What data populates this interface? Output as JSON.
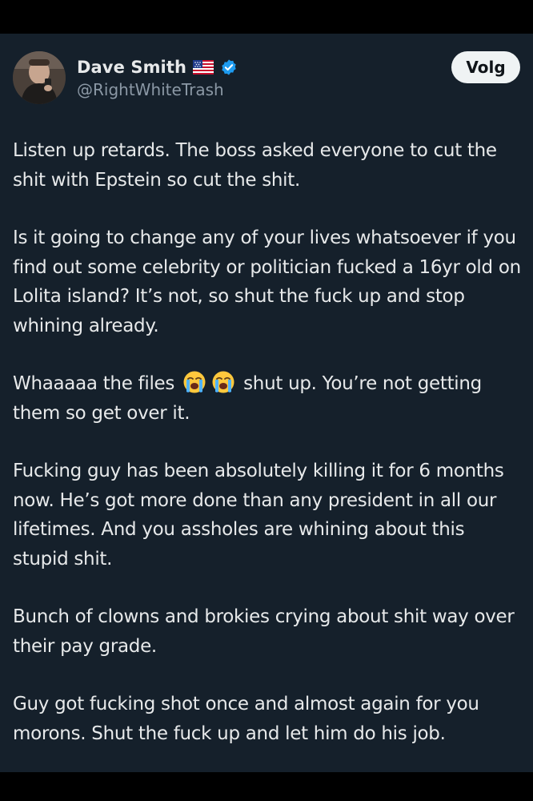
{
  "author": {
    "display_name": "Dave Smith",
    "handle": "@RightWhiteTrash",
    "flag_icon": "us-flag-icon",
    "verified_icon": "verified-badge-icon",
    "verified_color": "#1d9bf0"
  },
  "follow_button": {
    "label": "Volg"
  },
  "post": {
    "p1": "Listen up retards. The boss asked everyone to cut the shit with Epstein so cut the shit.",
    "p2": "Is it going to change any of your lives whatsoever if you find out some celebrity or politician fucked a 16yr old on Lolita island? It’s not, so shut the fuck up and stop whining already.",
    "p3_before": "Whaaaaa the files ",
    "p3_emoji": "loudly-crying-face-icon",
    "p3_after": " shut up. You’re not getting them so get over it.",
    "p4": "Fucking guy has been absolutely killing it for 6 months now. He’s got more done than any president in all our lifetimes. And you assholes are whining about this stupid shit.",
    "p5": "Bunch of clowns and brokies crying about shit way over their pay grade.",
    "p6": "Guy got fucking shot once and almost again for you morons. Shut the fuck up and let him do his job."
  },
  "colors": {
    "background": "#15202b",
    "text": "#e7e9ea",
    "secondary_text": "#8b98a5",
    "follow_bg": "#eff3f4"
  }
}
